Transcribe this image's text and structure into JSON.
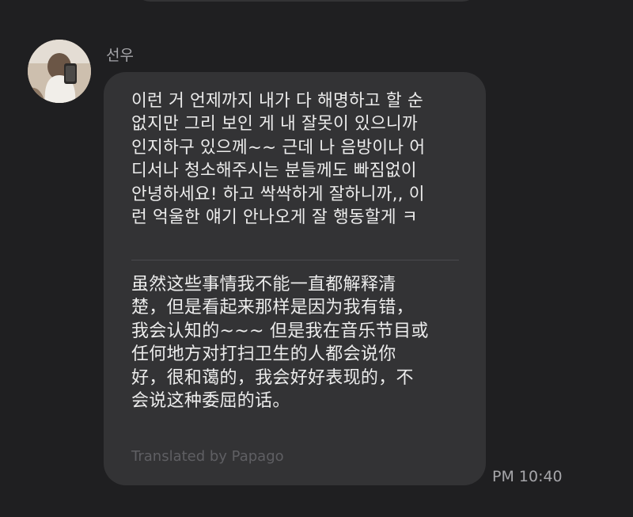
{
  "message": {
    "sender": "선우",
    "avatar_icon": "profile-photo",
    "original_text": "이런 거 언제까지 내가 다 해명하고 할 순\n없지만 그리 보인 게 내 잘못이 있으니까\n인지하구 있으께~~ 근데 나 음방이나 어\n디서나 청소해주시는 분들께도 빠짐없이\n안녕하세요! 하고 싹싹하게 잘하니까,, 이\n런 억울한 얘기 안나오게 잘 행동할게 ㅋ",
    "translated_text": "虽然这些事情我不能一直都解释清\n楚，但是看起来那样是因为我有错，\n我会认知的~~~ 但是我在音乐节目或\n任何地方对打扫卫生的人都会说你\n好，很和蔼的，我会好好表现的，不\n会说这种委屈的话。",
    "translator_credit": "Translated by Papago",
    "time": "PM 10:40"
  },
  "colors": {
    "background": "#1f1f21",
    "bubble": "#333335",
    "text": "#ececec",
    "secondary_text": "#a6a6aa",
    "credit_text": "#5f5f63"
  }
}
